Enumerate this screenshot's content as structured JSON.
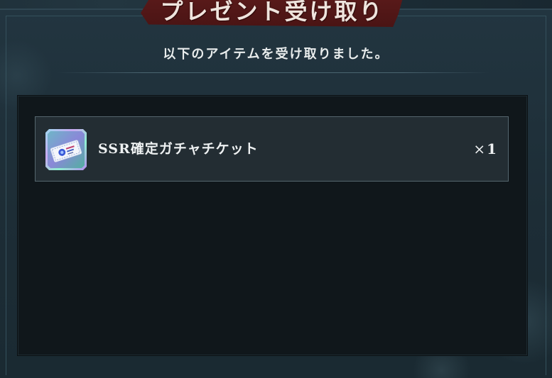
{
  "dialog": {
    "title": "プレゼント受け取り",
    "subtitle": "以下のアイテムを受け取りました。"
  },
  "items": [
    {
      "name": "SSR確定ガチャチケット",
      "quantity_prefix": "×",
      "quantity": "1",
      "icon": "gacha-ticket-icon"
    }
  ],
  "colors": {
    "banner": "#5a1a1a",
    "panel": "#10171b",
    "item_row": "#232d33",
    "item_border": "#55666e",
    "text": "#eef1f2"
  }
}
